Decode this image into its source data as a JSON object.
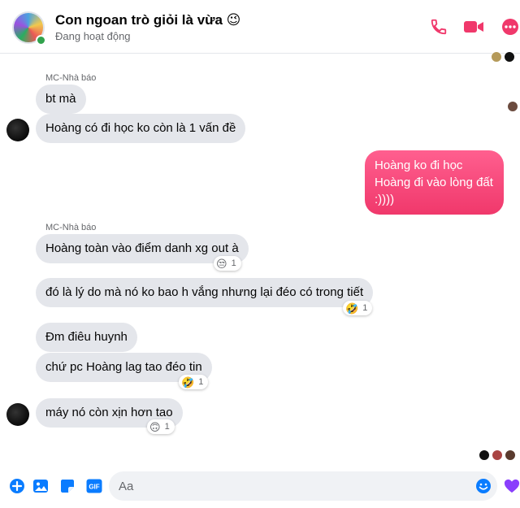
{
  "header": {
    "title": "Con ngoan trò giỏi là vừa 😉",
    "status": "Đang hoạt động"
  },
  "messages": {
    "group1_sender": "MC-Nhà báo",
    "m1": "bt mà",
    "m2": "Hoàng có đi học ko còn là 1 vấn đề",
    "out1": "Hoàng ko đi học Hoàng đi vào lòng đất :))))",
    "group2_sender": "MC-Nhà báo",
    "m3": "Hoàng toàn vào điểm danh xg out à",
    "m3_reaction": {
      "emoji": "😒",
      "count": "1"
    },
    "m4": "đó là lý do mà nó ko bao h vắng nhưng lại đéo có trong tiết",
    "m4_reaction": {
      "emoji": "🤣",
      "count": "1"
    },
    "m5": "Đm điêu huynh",
    "m6": "chứ pc Hoàng lag tao đéo tin",
    "m6_reaction": {
      "emoji": "🤣",
      "count": "1"
    },
    "m7": "máy nó còn xịn hơn tao",
    "m7_reaction": {
      "emoji": "🙃",
      "count": "1"
    }
  },
  "composer": {
    "placeholder": "Aa"
  },
  "colors": {
    "accent": "#f0386b",
    "online": "#31a24c",
    "bubble_in": "#e4e6eb",
    "like_purple": "#8a3ffc"
  },
  "icons": [
    "phone-icon",
    "video-icon",
    "more-icon",
    "plus-icon",
    "image-icon",
    "sticker-icon",
    "gif-icon",
    "emoji-icon",
    "like-icon"
  ]
}
